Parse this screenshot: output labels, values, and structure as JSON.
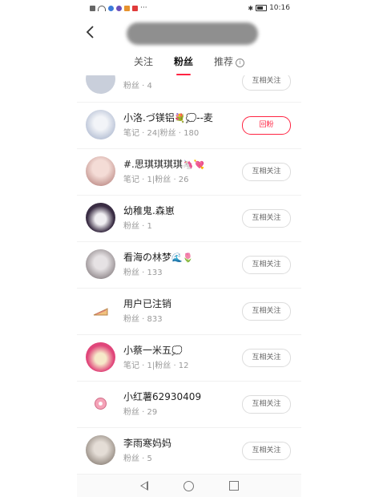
{
  "status_bar": {
    "time": "10:16",
    "more": "···"
  },
  "tabs": [
    {
      "label": "关注",
      "active": false
    },
    {
      "label": "粉丝",
      "active": true
    },
    {
      "label": "推荐",
      "active": false
    }
  ],
  "info_glyph": "i",
  "users": [
    {
      "name": "",
      "meta": "粉丝 · 4",
      "button": "互相关注",
      "avatar_color": "#c9cfdb"
    },
    {
      "name": "小洛.づ镁铝",
      "emoji": "💐💭",
      "name_suffix": "--麦",
      "meta": "笔记 · 24|粉丝 · 180",
      "button": "回粉",
      "primary": true,
      "avatar_color": "#cfd6e6"
    },
    {
      "name": "#.思琪琪琪琪",
      "emoji": "🦄💘",
      "meta": "笔记 · 1|粉丝 · 26",
      "button": "互相关注",
      "avatar_color": "#e7c9c5"
    },
    {
      "name": "幼稚鬼.森崽",
      "meta": "粉丝 · 1",
      "button": "互相关注",
      "avatar_color": "#4a3b52"
    },
    {
      "name": "看海の林梦",
      "emoji": "🌊🌷",
      "meta": "粉丝 · 133",
      "button": "互相关注",
      "avatar_color": "#b8b2b5"
    },
    {
      "name": "用户已注销",
      "meta": "粉丝 · 833",
      "button": "互相关注",
      "avatar_color": "#ffffff"
    },
    {
      "name": "小蔡一米五",
      "emoji": "💭",
      "meta": "笔记 · 1|粉丝 · 12",
      "button": "互相关注",
      "avatar_color": "#e0467a"
    },
    {
      "name": "小红薯62930409",
      "meta": "粉丝 · 29",
      "button": "互相关注",
      "avatar_color": "#ffffff"
    },
    {
      "name": "李雨寒妈妈",
      "meta": "粉丝 · 5",
      "button": "互相关注",
      "avatar_color": "#b3aaa3"
    }
  ],
  "colors": {
    "accent": "#ff2442",
    "text": "#222222",
    "meta": "#999999"
  }
}
